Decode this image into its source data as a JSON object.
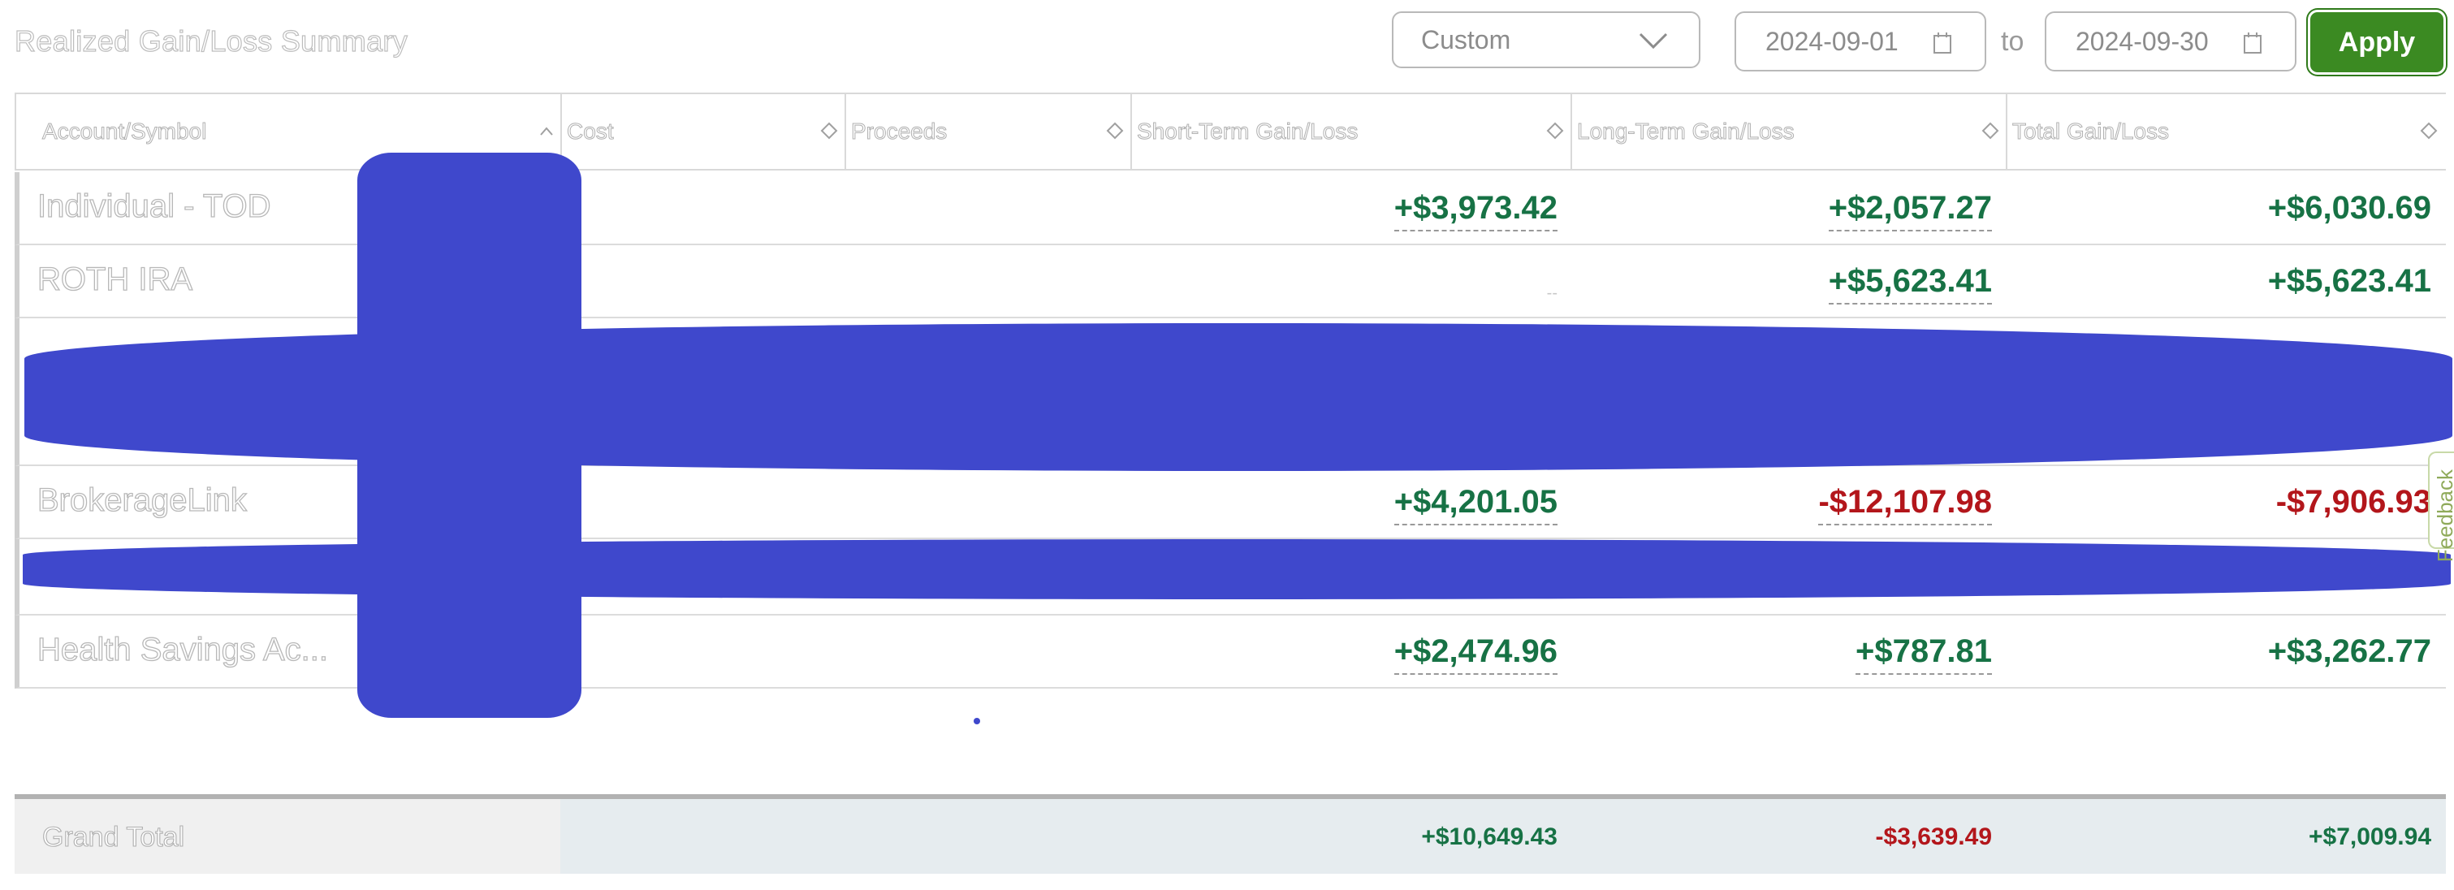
{
  "header": {
    "title": "Realized Gain/Loss Summary",
    "range_value": "Custom",
    "from_date": "2024-09-01",
    "to_label": "to",
    "to_date": "2024-09-30",
    "apply_label": "Apply"
  },
  "table": {
    "columns": [
      {
        "label": "Account/Symbol",
        "sort": "asc"
      },
      {
        "label": "Cost",
        "sort": "none"
      },
      {
        "label": "Proceeds",
        "sort": "none"
      },
      {
        "label": "Short-Term Gain/Loss",
        "sort": "none"
      },
      {
        "label": "Long-Term Gain/Loss",
        "sort": "none"
      },
      {
        "label": "Total Gain/Loss",
        "sort": "none"
      }
    ],
    "rows": [
      {
        "account": "Individual - TOD",
        "short_term": "+$3,973.42",
        "long_term": "+$2,057.27",
        "total": "+$6,030.69"
      },
      {
        "account": "ROTH IRA",
        "short_term": "--",
        "long_term": "+$5,623.41",
        "total": "+$5,623.41"
      },
      {
        "account": "BrokerageLink",
        "short_term": "+$4,201.05",
        "long_term": "-$12,107.98",
        "total": "-$7,906.93"
      },
      {
        "account": "Health Savings Ac...",
        "short_term": "+$2,474.96",
        "long_term": "+$787.81",
        "total": "+$3,262.77"
      }
    ]
  },
  "grand_total": {
    "label": "Grand Total",
    "short_term": "+$10,649.43",
    "long_term": "-$3,639.49",
    "total": "+$7,009.94"
  },
  "feedback_label": "Feedback",
  "colors": {
    "positive": "#177245",
    "negative": "#b3161b",
    "apply_bg": "#3b8a22",
    "redaction": "#3f48cc"
  }
}
